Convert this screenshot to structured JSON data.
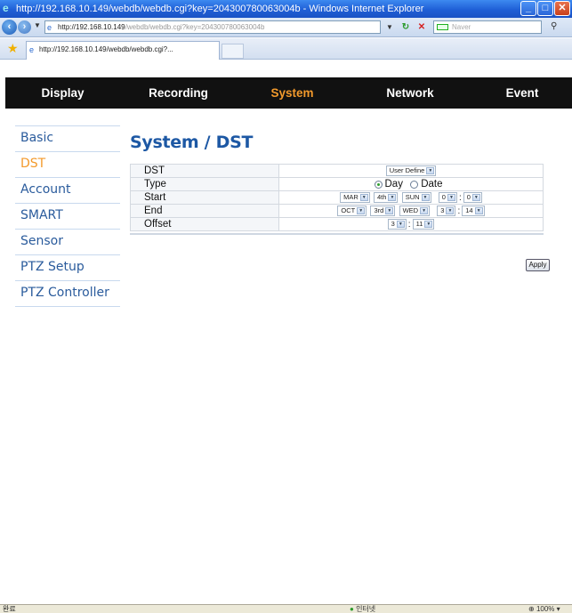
{
  "browser": {
    "title": "http://192.168.10.149/webdb/webdb.cgi?key=204300780063004b - Windows Internet Explorer",
    "url_host": "http://192.168.10.149",
    "url_path": "/webdb/webdb.cgi?key=204300780063004b",
    "search_placeholder": "Naver",
    "tab_title": "http://192.168.10.149/webdb/webdb.cgi?...",
    "status_left": "완료",
    "status_zone": "인터넷",
    "zoom": "100%"
  },
  "nav": {
    "items": [
      "Display",
      "Recording",
      "System",
      "Network",
      "Event"
    ],
    "active": "System"
  },
  "sidebar": {
    "items": [
      "Basic",
      "DST",
      "Account",
      "SMART",
      "Sensor",
      "PTZ Setup",
      "PTZ Controller"
    ],
    "active": "DST"
  },
  "content": {
    "heading": "System / DST",
    "rows": {
      "dst_label": "DST",
      "dst_value": "User Define",
      "type_label": "Type",
      "type_day": "Day",
      "type_date": "Date",
      "type_selected": "Day",
      "start_label": "Start",
      "start_month": "MAR",
      "start_week": "4th",
      "start_day": "SUN",
      "start_hour": "0",
      "start_min": "0",
      "end_label": "End",
      "end_month": "OCT",
      "end_week": "3rd",
      "end_day": "WED",
      "end_hour": "3",
      "end_min": "14",
      "offset_label": "Offset",
      "offset_hour": "3",
      "offset_min": "11",
      "colon": ":"
    },
    "apply_label": "Apply"
  },
  "colors": {
    "accent": "#f39a2c",
    "link": "#2a5b9c",
    "heading": "#1d58a4",
    "nav_bg": "#111111"
  }
}
